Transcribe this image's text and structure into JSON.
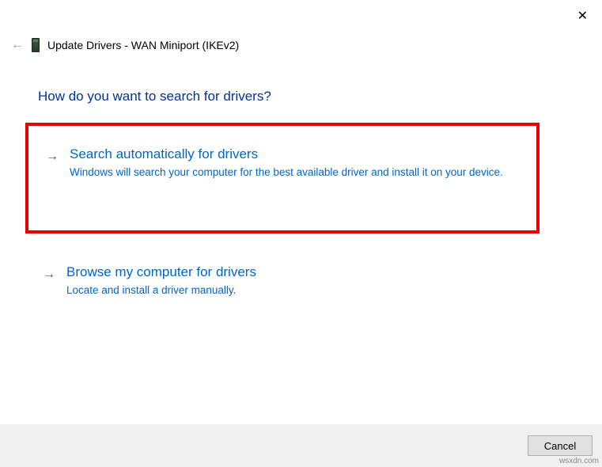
{
  "header": {
    "title": "Update Drivers - WAN Miniport (IKEv2)"
  },
  "question": "How do you want to search for drivers?",
  "options": {
    "auto": {
      "title": "Search automatically for drivers",
      "desc": "Windows will search your computer for the best available driver and install it on your device."
    },
    "browse": {
      "title": "Browse my computer for drivers",
      "desc": "Locate and install a driver manually."
    }
  },
  "footer": {
    "cancel": "Cancel"
  },
  "watermark": "wsxdn.com"
}
